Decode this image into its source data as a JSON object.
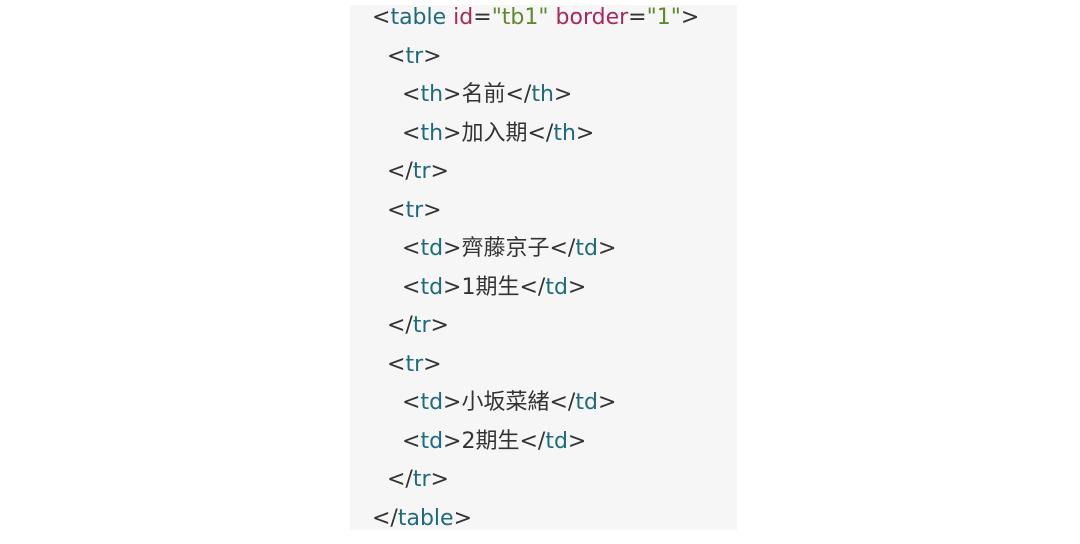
{
  "code": {
    "lines": [
      {
        "indent": 0,
        "parts": [
          {
            "t": "punct",
            "v": "<"
          },
          {
            "t": "tag",
            "v": "table"
          },
          {
            "t": "punct",
            "v": " "
          },
          {
            "t": "attr",
            "v": "id"
          },
          {
            "t": "punct",
            "v": "="
          },
          {
            "t": "val",
            "v": "\"tb1\""
          },
          {
            "t": "punct",
            "v": " "
          },
          {
            "t": "attr",
            "v": "border"
          },
          {
            "t": "punct",
            "v": "="
          },
          {
            "t": "val",
            "v": "\"1\""
          },
          {
            "t": "punct",
            "v": ">"
          }
        ]
      },
      {
        "indent": 1,
        "parts": [
          {
            "t": "punct",
            "v": "<"
          },
          {
            "t": "tag",
            "v": "tr"
          },
          {
            "t": "punct",
            "v": ">"
          }
        ]
      },
      {
        "indent": 2,
        "parts": [
          {
            "t": "punct",
            "v": "<"
          },
          {
            "t": "tag",
            "v": "th"
          },
          {
            "t": "punct",
            "v": ">"
          },
          {
            "t": "text",
            "v": "名前"
          },
          {
            "t": "punct",
            "v": "</"
          },
          {
            "t": "tag",
            "v": "th"
          },
          {
            "t": "punct",
            "v": ">"
          }
        ]
      },
      {
        "indent": 2,
        "parts": [
          {
            "t": "punct",
            "v": "<"
          },
          {
            "t": "tag",
            "v": "th"
          },
          {
            "t": "punct",
            "v": ">"
          },
          {
            "t": "text",
            "v": "加入期"
          },
          {
            "t": "punct",
            "v": "</"
          },
          {
            "t": "tag",
            "v": "th"
          },
          {
            "t": "punct",
            "v": ">"
          }
        ]
      },
      {
        "indent": 1,
        "parts": [
          {
            "t": "punct",
            "v": "</"
          },
          {
            "t": "tag",
            "v": "tr"
          },
          {
            "t": "punct",
            "v": ">"
          }
        ]
      },
      {
        "indent": 1,
        "parts": [
          {
            "t": "punct",
            "v": "<"
          },
          {
            "t": "tag",
            "v": "tr"
          },
          {
            "t": "punct",
            "v": ">"
          }
        ]
      },
      {
        "indent": 2,
        "parts": [
          {
            "t": "punct",
            "v": "<"
          },
          {
            "t": "tag",
            "v": "td"
          },
          {
            "t": "punct",
            "v": ">"
          },
          {
            "t": "text",
            "v": "齊藤京子"
          },
          {
            "t": "punct",
            "v": "</"
          },
          {
            "t": "tag",
            "v": "td"
          },
          {
            "t": "punct",
            "v": ">"
          }
        ]
      },
      {
        "indent": 2,
        "parts": [
          {
            "t": "punct",
            "v": "<"
          },
          {
            "t": "tag",
            "v": "td"
          },
          {
            "t": "punct",
            "v": ">"
          },
          {
            "t": "text",
            "v": "1期生"
          },
          {
            "t": "punct",
            "v": "</"
          },
          {
            "t": "tag",
            "v": "td"
          },
          {
            "t": "punct",
            "v": ">"
          }
        ]
      },
      {
        "indent": 1,
        "parts": [
          {
            "t": "punct",
            "v": "</"
          },
          {
            "t": "tag",
            "v": "tr"
          },
          {
            "t": "punct",
            "v": ">"
          }
        ]
      },
      {
        "indent": 1,
        "parts": [
          {
            "t": "punct",
            "v": "<"
          },
          {
            "t": "tag",
            "v": "tr"
          },
          {
            "t": "punct",
            "v": ">"
          }
        ]
      },
      {
        "indent": 2,
        "parts": [
          {
            "t": "punct",
            "v": "<"
          },
          {
            "t": "tag",
            "v": "td"
          },
          {
            "t": "punct",
            "v": ">"
          },
          {
            "t": "text",
            "v": "小坂菜緒"
          },
          {
            "t": "punct",
            "v": "</"
          },
          {
            "t": "tag",
            "v": "td"
          },
          {
            "t": "punct",
            "v": ">"
          }
        ]
      },
      {
        "indent": 2,
        "parts": [
          {
            "t": "punct",
            "v": "<"
          },
          {
            "t": "tag",
            "v": "td"
          },
          {
            "t": "punct",
            "v": ">"
          },
          {
            "t": "text",
            "v": "2期生"
          },
          {
            "t": "punct",
            "v": "</"
          },
          {
            "t": "tag",
            "v": "td"
          },
          {
            "t": "punct",
            "v": ">"
          }
        ]
      },
      {
        "indent": 1,
        "parts": [
          {
            "t": "punct",
            "v": "</"
          },
          {
            "t": "tag",
            "v": "tr"
          },
          {
            "t": "punct",
            "v": ">"
          }
        ]
      },
      {
        "indent": 0,
        "parts": [
          {
            "t": "punct",
            "v": "</"
          },
          {
            "t": "tag",
            "v": "table"
          },
          {
            "t": "punct",
            "v": ">"
          }
        ]
      }
    ]
  },
  "colors": {
    "background": "#f6f6f6",
    "tag": "#1e6b7e",
    "attribute": "#a8285c",
    "value": "#5e8a2a",
    "text": "#333333"
  }
}
